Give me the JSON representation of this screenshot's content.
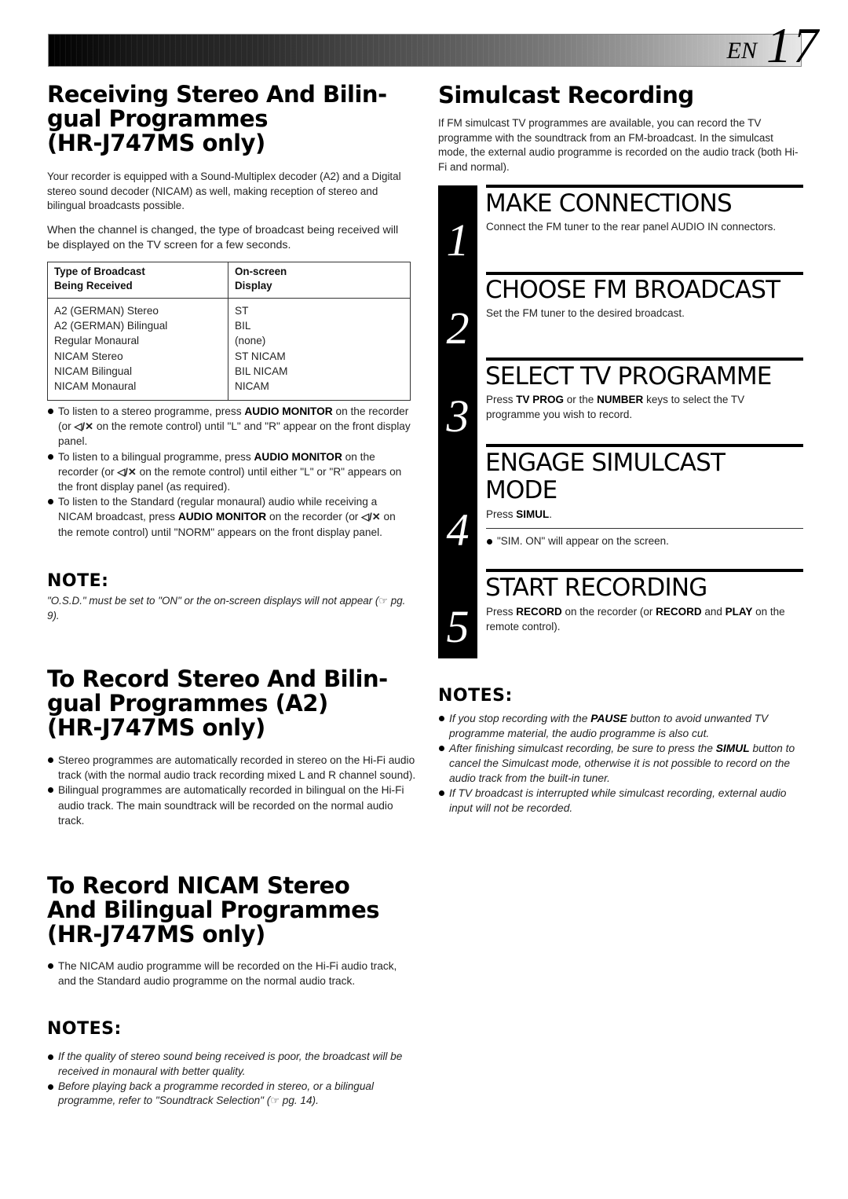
{
  "header": {
    "lang": "EN",
    "page_number": "17"
  },
  "left": {
    "section1": {
      "title_lines": [
        "Receiving Stereo And Bilin-",
        "gual Programmes",
        "(HR-J747MS only)"
      ],
      "para1": "Your recorder is equipped with a Sound-Multiplex decoder (A2) and a Digital stereo sound decoder (NICAM) as well, making reception of stereo and bilingual broadcasts possible.",
      "para2": "When the channel is changed, the type of broadcast being received will be displayed on the TV screen for a few seconds.",
      "table": {
        "headers": [
          [
            "Type of Broadcast",
            "Being Received"
          ],
          [
            "On-screen",
            "Display"
          ]
        ],
        "rows": [
          [
            "A2 (GERMAN) Stereo",
            "ST"
          ],
          [
            "A2 (GERMAN) Bilingual",
            "BIL"
          ],
          [
            "Regular Monaural",
            "(none)"
          ],
          [
            "NICAM Stereo",
            "ST NICAM"
          ],
          [
            "NICAM Bilingual",
            "BIL NICAM"
          ],
          [
            "NICAM Monaural",
            "NICAM"
          ]
        ]
      },
      "bullets": [
        {
          "pre": "To listen to a stereo programme, press ",
          "bold": "AUDIO MONITOR",
          "mid": " on the recorder (or ",
          "icon": "audio-monitor-icon",
          "post": " on the remote control) until \"L\" and \"R\" appear on the front display panel."
        },
        {
          "pre": "To listen to a bilingual programme, press ",
          "bold": "AUDIO MONITOR",
          "mid": " on the recorder (or ",
          "icon": "audio-monitor-icon",
          "post": " on the remote control) until either \"L\" or \"R\" appears on the front display panel (as required)."
        },
        {
          "pre": "To listen to the Standard (regular monaural) audio while receiving a NICAM broadcast, press ",
          "bold": "AUDIO MONITOR",
          "mid": " on the recorder (or ",
          "icon": "audio-monitor-icon",
          "post": " on the remote control) until \"NORM\" appears on the front display panel."
        }
      ],
      "icon_glyph": "◁/✕",
      "note_heading": "NOTE:",
      "note_text_pre": "\"O.S.D.\" must be set to \"ON\" or the on-screen displays will not appear (",
      "note_pointer": "☞",
      "note_text_post": " pg. 9)."
    },
    "section2": {
      "title_lines": [
        "To Record Stereo And Bilin-",
        "gual Programmes (A2)",
        "(HR-J747MS only)"
      ],
      "bullets": [
        "Stereo programmes are automatically recorded in stereo on the Hi-Fi audio track (with the normal audio track recording mixed L and R channel sound).",
        "Bilingual programmes are automatically recorded in bilingual on the Hi-Fi audio track. The main soundtrack will be recorded on the normal audio track."
      ]
    },
    "section3": {
      "title_lines": [
        "To Record NICAM Stereo",
        "And Bilingual Programmes",
        "(HR-J747MS only)"
      ],
      "bullets": [
        "The NICAM audio programme will be recorded on the Hi-Fi audio track, and the Standard audio programme on the normal audio track."
      ],
      "notes_heading": "NOTES:",
      "notes": [
        {
          "text": "If the quality of stereo sound being received is poor, the broadcast will be received in monaural with better quality."
        },
        {
          "text_pre": "Before playing back a programme recorded in stereo, or a bilingual programme, refer to \"Soundtrack Selection\" (",
          "pointer": "☞",
          "text_post": " pg. 14)."
        }
      ]
    }
  },
  "right": {
    "title": "Simulcast Recording",
    "intro": "If FM simulcast TV programmes are available, you can record the TV programme with the soundtrack from an FM-broadcast. In the simulcast mode, the external audio programme is recorded on the audio track (both Hi-Fi and normal).",
    "steps": [
      {
        "number": "1",
        "title": "MAKE CONNECTIONS",
        "text": "Connect the FM tuner to the rear panel AUDIO IN connectors."
      },
      {
        "number": "2",
        "title": "CHOOSE FM BROADCAST",
        "text": "Set the FM tuner to the desired broadcast."
      },
      {
        "number": "3",
        "title": "SELECT TV PROGRAMME",
        "text_parts": [
          "Press ",
          "TV PROG",
          " or the ",
          "NUMBER",
          " keys to select the TV programme you wish to record."
        ]
      },
      {
        "number": "4",
        "title_lines": [
          "ENGAGE SIMULCAST",
          "MODE"
        ],
        "text_parts": [
          "Press ",
          "SIMUL",
          "."
        ],
        "bullet": "\"SIM. ON\" will appear on the screen."
      },
      {
        "number": "5",
        "title": "START RECORDING",
        "text_parts": [
          "Press ",
          "RECORD",
          " on the recorder (or ",
          "RECORD",
          " and ",
          "PLAY",
          " on the remote control)."
        ]
      }
    ],
    "notes_heading": "NOTES:",
    "notes": [
      {
        "pre": "If you stop recording with the ",
        "bold": "PAUSE",
        "post": " button to avoid unwanted TV programme material, the audio programme is also cut."
      },
      {
        "pre": "After finishing simulcast recording, be sure to press the ",
        "bold": "SIMUL",
        "post": " button to cancel the Simulcast mode, otherwise it is not possible to record on the audio track from the built-in tuner."
      },
      {
        "pre": "If TV broadcast is interrupted while simulcast recording, external audio input will not be recorded.",
        "bold": "",
        "post": ""
      }
    ]
  }
}
